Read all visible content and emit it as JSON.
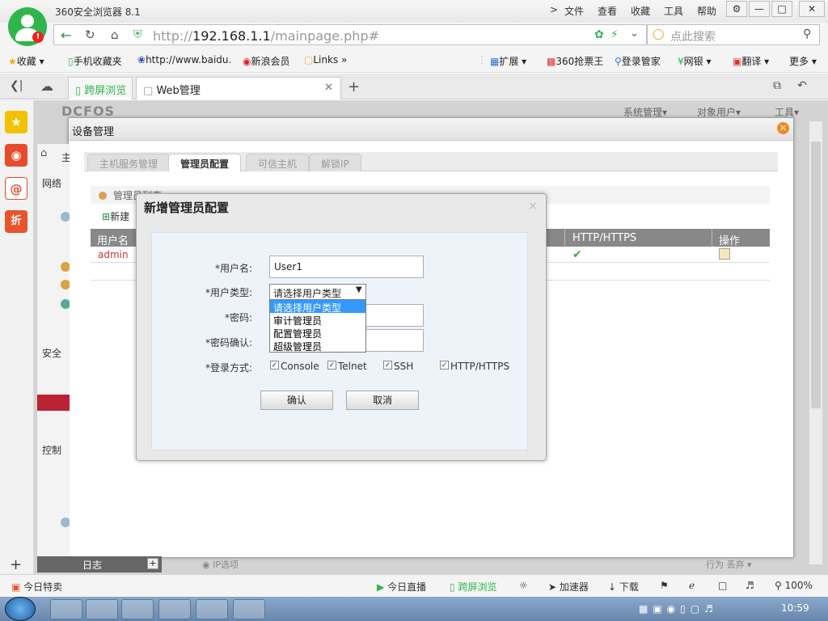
{
  "browser": {
    "app_title": "360安全浏览器 8.1",
    "menus": [
      "文件",
      "查看",
      "收藏",
      "工具",
      "帮助"
    ],
    "menu_arrow": ">",
    "window_buttons": [
      "⚙",
      "—",
      "□",
      "✕"
    ],
    "url_prefix": "http://",
    "url_host": "192.168.1.1",
    "url_path": "/mainpage.php#",
    "search_placeholder": "点此搜索",
    "bookmarks": [
      "收藏",
      "手机收藏夹",
      "http://www.baidu.",
      "新浪会员",
      "Links",
      "扩展",
      "360抢票王",
      "登录管家",
      "网银",
      "翻译",
      "更多"
    ],
    "tabs": [
      {
        "label": "跨屏浏览"
      },
      {
        "label": "Web管理"
      }
    ],
    "new_tab": "+",
    "status_items": [
      "今日特卖",
      "今日直播",
      "跨屏浏览",
      "加速器",
      "下载",
      "100%"
    ],
    "clock": "10:59"
  },
  "app": {
    "brand": "DCFOS",
    "topnav": [
      "系统管理",
      "对象用户",
      "工具"
    ],
    "sidebar_sections": [
      "网络",
      "安全",
      "控制"
    ],
    "sidebar_home": "主",
    "log_label": "日志",
    "bottom_left": "IP选项",
    "bottom_right": "行为",
    "bottom_right_select": "丢弃"
  },
  "device_dialog": {
    "title": "设备管理",
    "tabs": [
      "主机服务管理",
      "管理员配置",
      "可信主机",
      "解锁IP"
    ],
    "active_tab": 1,
    "list_title": "管理员列表",
    "new_button": "新建",
    "columns": [
      "用户名",
      "HTTP/HTTPS",
      "操作"
    ],
    "rows": [
      {
        "username": "admin"
      }
    ]
  },
  "modal": {
    "title": "新增管理员配置",
    "close": "×",
    "fields": {
      "username_label": "*用户名:",
      "username_value": "User1",
      "usertype_label": "*用户类型:",
      "usertype_value": "请选择用户类型",
      "password_label": "*密码:",
      "password_confirm_label": "*密码确认:",
      "login_label": "*登录方式:"
    },
    "usertype_options": [
      "请选择用户类型",
      "审计管理员",
      "配置管理员",
      "超级管理员"
    ],
    "login_methods": [
      {
        "label": "Console",
        "checked": true
      },
      {
        "label": "Telnet",
        "checked": true
      },
      {
        "label": "SSH",
        "checked": true
      },
      {
        "label": "HTTP/HTTPS",
        "checked": true
      }
    ],
    "confirm_button": "确认",
    "cancel_button": "取消"
  }
}
